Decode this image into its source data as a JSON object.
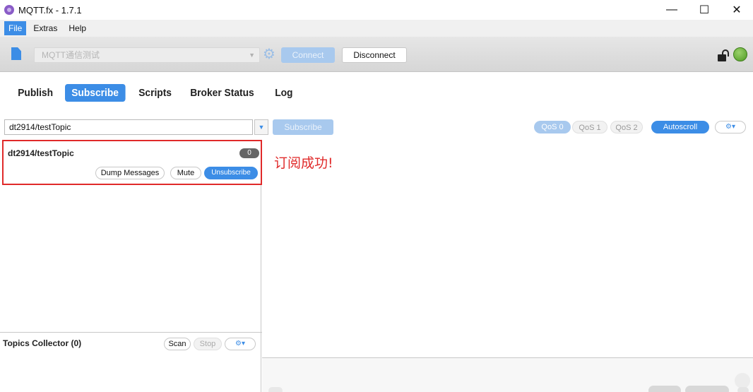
{
  "window": {
    "title": "MQTT.fx - 1.7.1",
    "minimize_glyph": "—",
    "maximize_glyph": "☐",
    "close_glyph": "✕"
  },
  "menu": {
    "items": [
      "File",
      "Extras",
      "Help"
    ],
    "active": "File"
  },
  "toolbar": {
    "profile_value": "MQTT通信测试",
    "connect_label": "Connect",
    "disconnect_label": "Disconnect",
    "connected": true
  },
  "tabs": {
    "items": [
      "Publish",
      "Subscribe",
      "Scripts",
      "Broker Status",
      "Log"
    ],
    "active": "Subscribe"
  },
  "subscribe": {
    "topic_value": "dt2914/testTopic",
    "subscribe_label": "Subscribe",
    "qos_options": [
      "QoS 0",
      "QoS 1",
      "QoS 2"
    ],
    "qos_selected": "QoS 0",
    "autoscroll_label": "Autoscroll"
  },
  "subscription": {
    "topic": "dt2914/testTopic",
    "count": "0",
    "dump_label": "Dump Messages",
    "mute_label": "Mute",
    "unsubscribe_label": "Unsubscribe"
  },
  "annotation": {
    "text": "订阅成功!"
  },
  "topics_collector": {
    "title": "Topics Collector (0)",
    "scan_label": "Scan",
    "stop_label": "Stop"
  },
  "icons": {
    "app": "mqttfx-app-icon",
    "profile": "document-icon",
    "settings": "gear-icon",
    "lock": "unlocked-padlock-icon",
    "status": "green-status-dot-icon"
  },
  "colors": {
    "accent": "#3c8de6",
    "highlight_box": "#e02a2a",
    "status_connected": "#4e9a23"
  }
}
